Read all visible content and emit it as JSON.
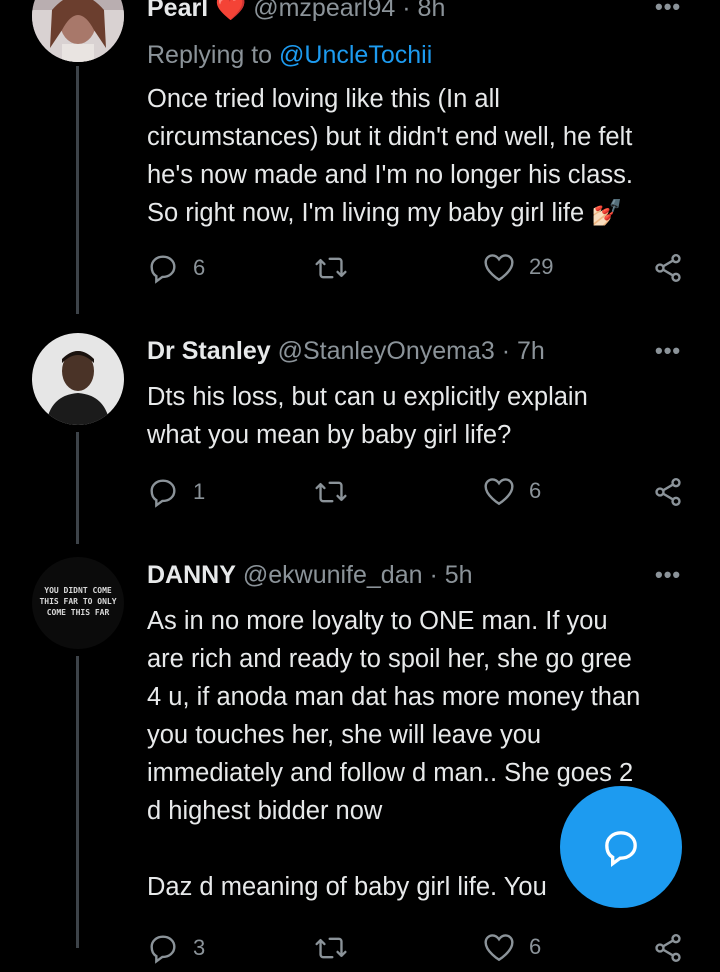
{
  "tweets": [
    {
      "name": "Pearl",
      "emoji": "❤️",
      "handle": "@mzpearl94",
      "time": "· 8h",
      "replying_prefix": "Replying to",
      "replying_handle": "@UncleTochii",
      "lines": [
        "Once tried loving like this (In all",
        "circumstances) but it didn't end well, he felt",
        "he's now made and I'm no longer his class.",
        "So right now, I'm living my baby girl life 💅🏻"
      ],
      "replies": "6",
      "retweets": "",
      "likes": "29"
    },
    {
      "name": "Dr Stanley",
      "handle": "@StanleyOnyema3",
      "time": "· 7h",
      "lines": [
        "Dts his loss, but can u explicitly explain",
        "what you mean by baby girl life?"
      ],
      "replies": "1",
      "retweets": "",
      "likes": "6"
    },
    {
      "name": "DANNY",
      "handle": "@ekwunife_dan",
      "time": "· 5h",
      "avatar_text": "YOU DIDNT COME THIS FAR TO ONLY COME THIS FAR",
      "lines": [
        "As in no more loyalty to ONE man. If you",
        "are rich and ready to spoil her, she go gree",
        "4 u, if anoda man dat has more money than",
        "you touches her, she will leave you",
        "immediately and follow d man.. She goes 2",
        "d highest bidder now"
      ],
      "line_last": "Daz d meaning of baby girl life. You",
      "replies": "3",
      "retweets": "",
      "likes": "6"
    }
  ],
  "icons": {
    "reply": "reply-icon",
    "retweet": "retweet-icon",
    "like": "heart-icon",
    "share": "share-icon",
    "more": "more-icon",
    "compose": "compose-icon"
  },
  "colors": {
    "background": "#000000",
    "text": "#e7e9ea",
    "muted": "#8b9399",
    "accent": "#1d9bf0",
    "heart_emoji": "#e0245e"
  }
}
